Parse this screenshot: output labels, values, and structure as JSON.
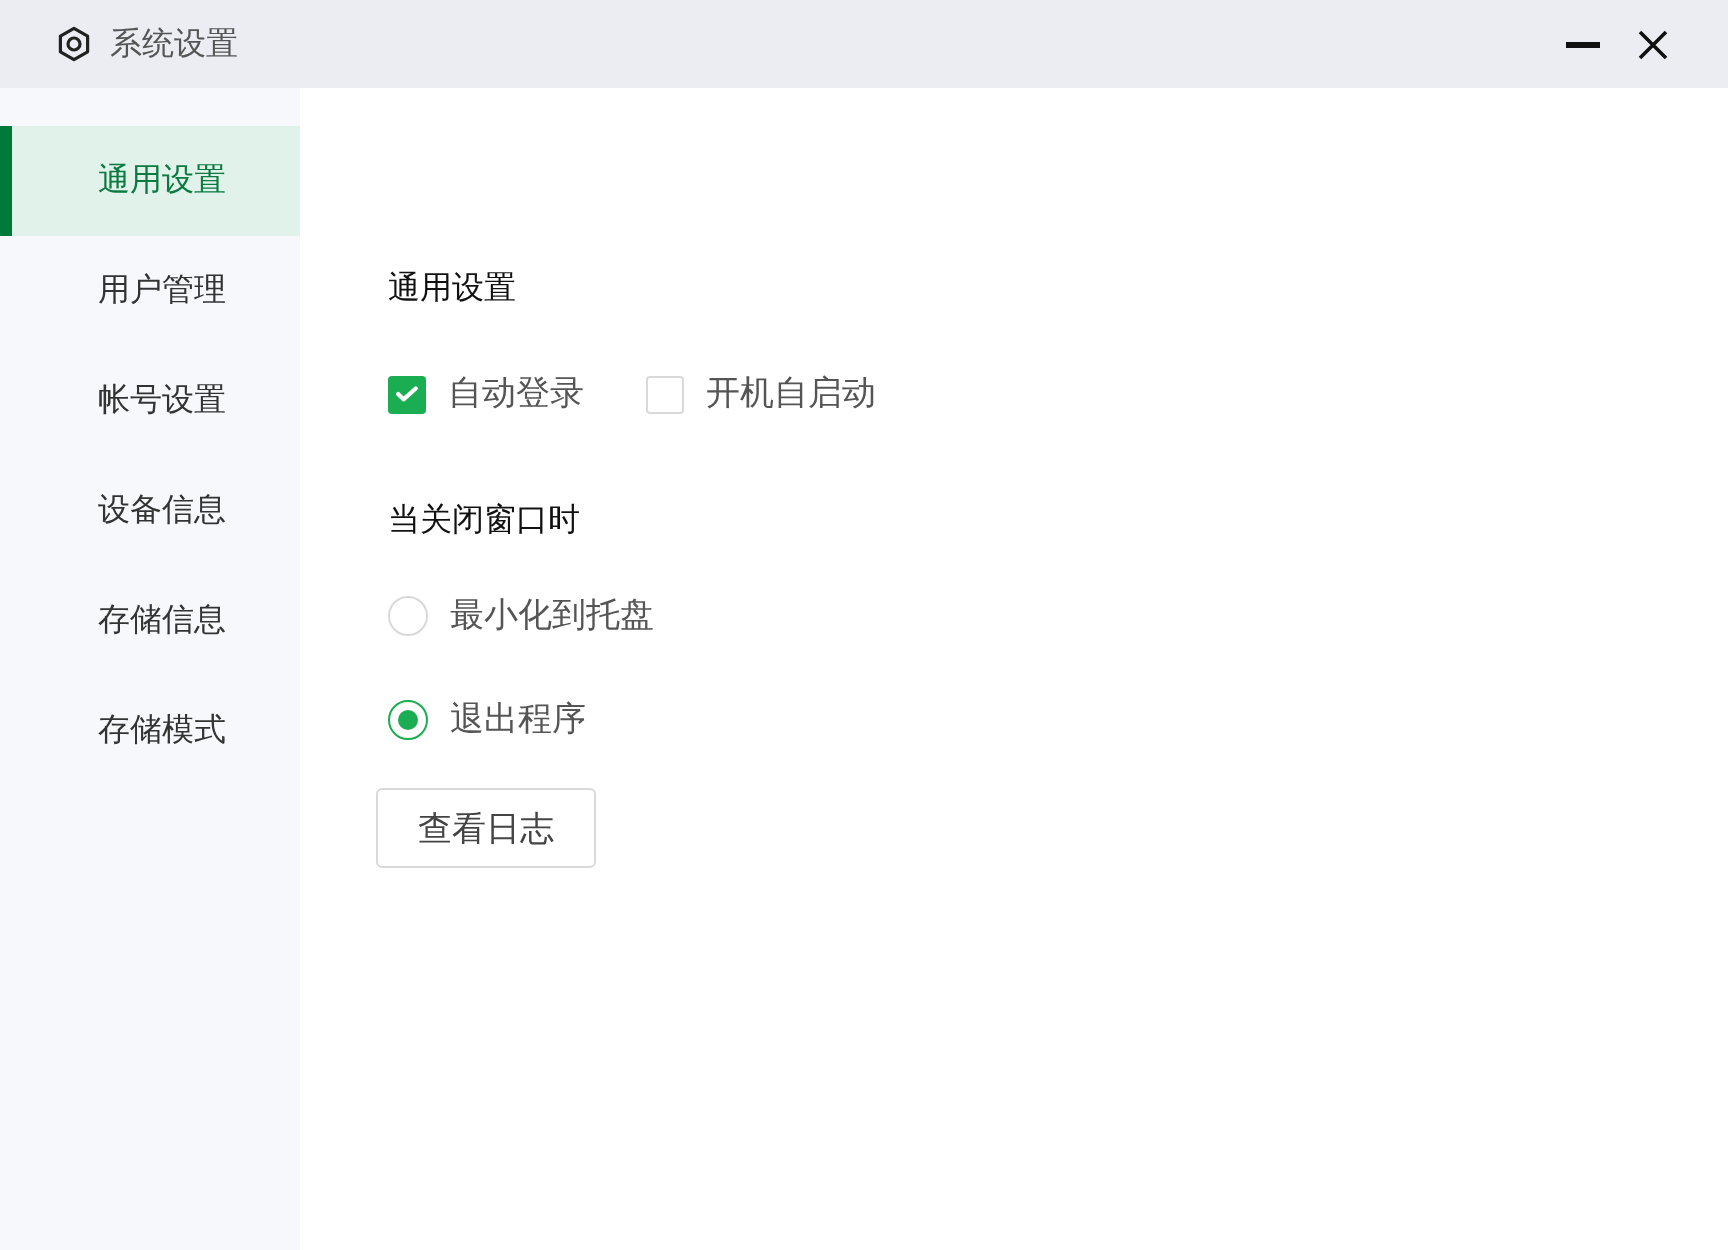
{
  "window": {
    "title": "系统设置"
  },
  "sidebar": {
    "items": [
      {
        "label": "通用设置",
        "selected": true
      },
      {
        "label": "用户管理",
        "selected": false
      },
      {
        "label": "帐号设置",
        "selected": false
      },
      {
        "label": "设备信息",
        "selected": false
      },
      {
        "label": "存储信息",
        "selected": false
      },
      {
        "label": "存储模式",
        "selected": false
      }
    ]
  },
  "general": {
    "title": "通用设置",
    "options": [
      {
        "label": "自动登录",
        "checked": true
      },
      {
        "label": "开机自启动",
        "checked": false
      }
    ]
  },
  "close_behavior": {
    "title": "当关闭窗口时",
    "options": [
      {
        "label": "最小化到托盘",
        "selected": false
      },
      {
        "label": "退出程序",
        "selected": true
      }
    ]
  },
  "log_button": {
    "label": "查看日志"
  }
}
